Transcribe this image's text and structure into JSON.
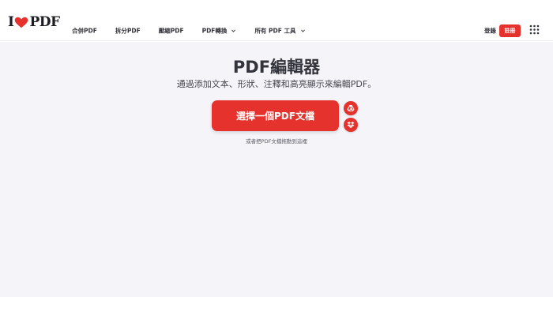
{
  "header": {
    "logo": {
      "prefix": "I",
      "suffix": "PDF",
      "heart_color": "#e5322d"
    },
    "nav": [
      {
        "label": "合併PDF"
      },
      {
        "label": "拆分PDF"
      },
      {
        "label": "壓縮PDF"
      },
      {
        "label": "PDF轉換",
        "has_dropdown": true
      },
      {
        "label": "所有 PDF 工具",
        "has_dropdown": true
      }
    ],
    "login_label": "登錄",
    "signup_label": "註冊",
    "apps_icon": "grid-icon"
  },
  "main": {
    "title": "PDF編輯器",
    "subtitle": "通過添加文本、形狀、注釋和高亮顯示來編輯PDF。",
    "select_button_label": "選擇一個PDF文檔",
    "cloud_buttons": [
      {
        "icon": "google-drive-icon"
      },
      {
        "icon": "dropbox-icon"
      }
    ],
    "drop_hint": "或者把PDF文檔拖動到這裡"
  },
  "colors": {
    "accent": "#e5322d",
    "main_background": "#f4f4f9",
    "text": "#33333b"
  }
}
